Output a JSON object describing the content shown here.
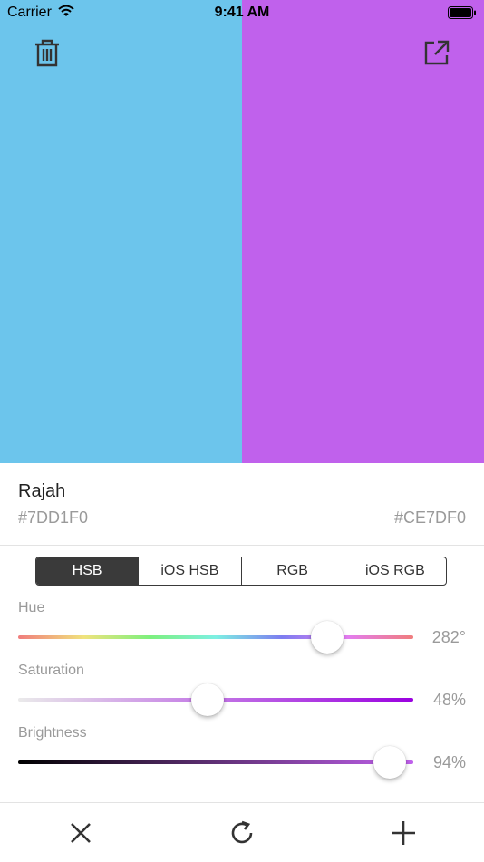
{
  "status_bar": {
    "carrier": "Carrier",
    "time": "9:41 AM"
  },
  "swatches": {
    "left_color": "#7DD1F0",
    "right_color": "#CE7DF0",
    "left_display": "#6CC5EC",
    "right_display": "#C061EC"
  },
  "icons": {
    "trash": "trash-icon",
    "share": "share-icon",
    "close": "close-icon",
    "refresh": "refresh-icon",
    "add": "plus-icon"
  },
  "info": {
    "name": "Rajah",
    "hex_left": "#7DD1F0",
    "hex_right": "#CE7DF0"
  },
  "modes": {
    "items": [
      "HSB",
      "iOS HSB",
      "RGB",
      "iOS RGB"
    ],
    "active": "HSB"
  },
  "sliders": [
    {
      "label": "Hue",
      "value_text": "282°",
      "fraction": 0.783
    },
    {
      "label": "Saturation",
      "value_text": "48%",
      "fraction": 0.48
    },
    {
      "label": "Brightness",
      "value_text": "94%",
      "fraction": 0.94
    }
  ]
}
